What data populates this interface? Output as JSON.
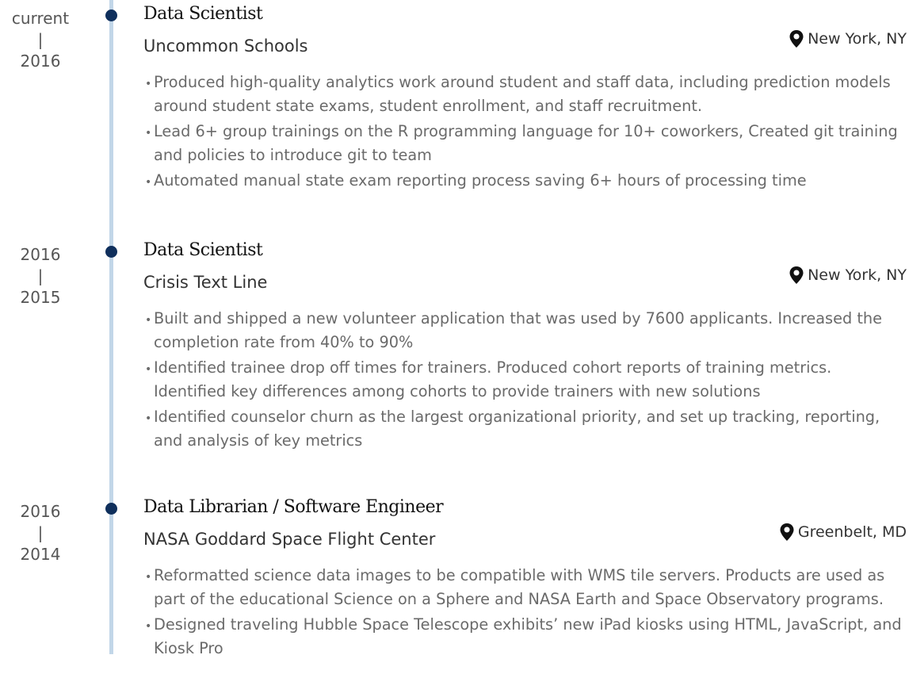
{
  "entries": [
    {
      "date_end": "current",
      "separator": "|",
      "date_start": "2016",
      "title": "Data Scientist",
      "organization": "Uncommon Schools",
      "location": "New York, NY",
      "location_icon": "map-pin-icon",
      "bullets": [
        "Produced high-quality analytics work around student and staff data, including prediction models around student state exams, student enrollment, and staff recruitment.",
        "Lead 6+ group trainings on the R programming language for 10+ coworkers, Created git training and policies to introduce git to team",
        "Automated manual state exam reporting process saving 6+ hours of processing time"
      ]
    },
    {
      "date_end": "2016",
      "separator": "|",
      "date_start": "2015",
      "title": "Data Scientist",
      "organization": "Crisis Text Line",
      "location": "New York, NY",
      "location_icon": "map-pin-icon",
      "bullets": [
        "Built and shipped a new volunteer application that was used by 7600 applicants. Increased the completion rate from 40% to 90%",
        "Identified trainee drop off times for trainers. Produced cohort reports of training metrics. Identified key differences among cohorts to provide trainers with new solutions",
        "Identified counselor churn as the largest organizational priority, and set up tracking, reporting, and analysis of key metrics"
      ]
    },
    {
      "date_end": "2016",
      "separator": "|",
      "date_start": "2014",
      "title": "Data Librarian / Software Engineer",
      "organization": "NASA Goddard Space Flight Center",
      "location": "Greenbelt, MD",
      "location_icon": "map-pin-icon",
      "bullets": [
        "Reformatted science data images to be compatible with WMS tile servers. Products are used as part of the educational Science on a Sphere and NASA Earth and Space Observatory programs.",
        "Designed traveling Hubble Space Telescope exhibits’ new iPad kiosks using HTML, JavaScript, and Kiosk Pro"
      ]
    }
  ],
  "colors": {
    "timeline_line": "#c2d6e8",
    "timeline_dot": "#0f2f5c",
    "bullet_text": "#6a6a6a"
  }
}
